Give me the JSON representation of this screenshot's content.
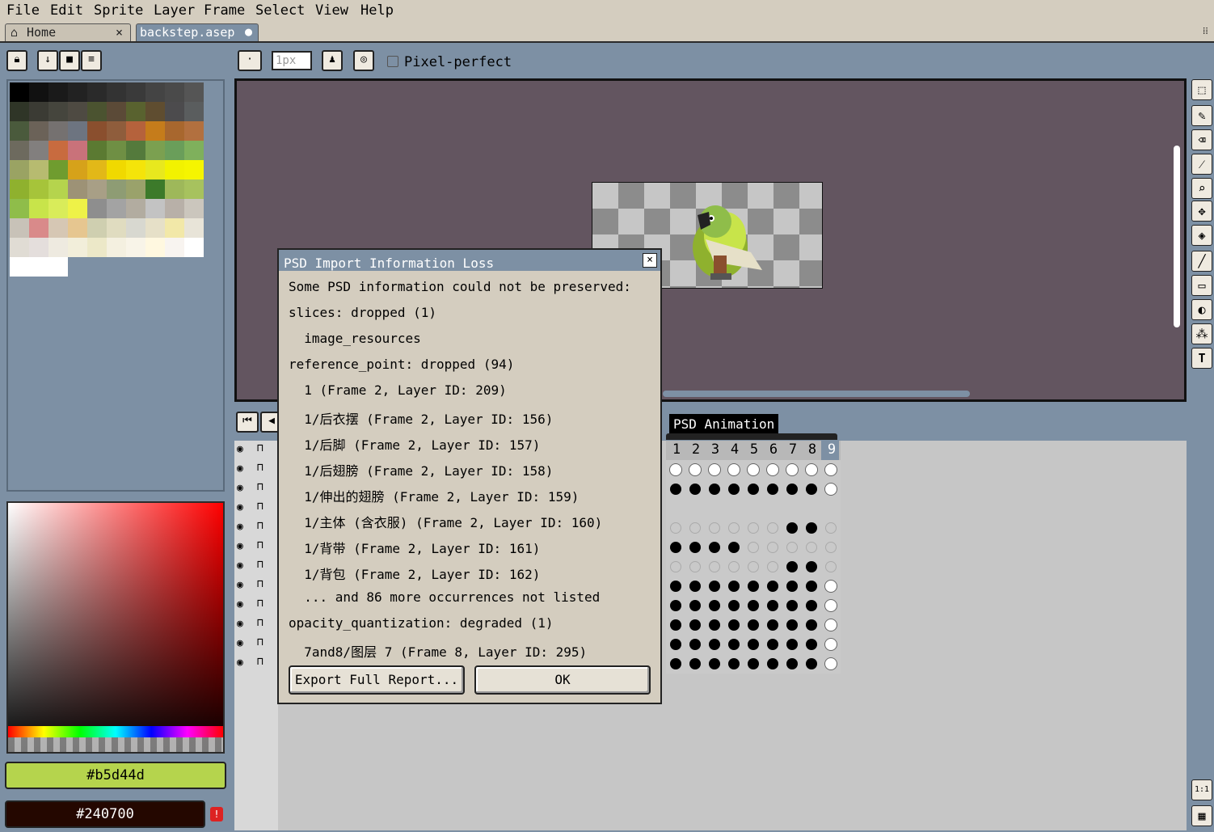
{
  "menu": [
    "File",
    "Edit",
    "Sprite",
    "Layer",
    "Frame",
    "Select",
    "View",
    "Help"
  ],
  "tabs": {
    "home": "Home",
    "file": "backstep.asep"
  },
  "toolbar": {
    "brush_size": "1px",
    "pixel_perfect": "Pixel-perfect"
  },
  "palette": {
    "colors": [
      "#000000",
      "#111111",
      "#1a1a1a",
      "#222222",
      "#2a2a2a",
      "#333333",
      "#3a3a3a",
      "#444444",
      "#4a4a4a",
      "#555555",
      "#2f3527",
      "#3b3b34",
      "#45453d",
      "#4e4a42",
      "#4b5330",
      "#5b4a37",
      "#59622f",
      "#5f4d30",
      "#4c4b4d",
      "#5a5d5e",
      "#4a5a3c",
      "#6b6258",
      "#757170",
      "#6d7480",
      "#8a4f2e",
      "#8f5d3c",
      "#b5623c",
      "#c57c1b",
      "#a8672e",
      "#b2703f",
      "#6d6a5e",
      "#827f7e",
      "#c86b3f",
      "#c9727a",
      "#5b7a32",
      "#6f8f44",
      "#547a3c",
      "#7ba050",
      "#6a9e5a",
      "#7fb05c",
      "#9aa363",
      "#b7bb70",
      "#6f9c2f",
      "#d6a21a",
      "#e2b818",
      "#f0d900",
      "#f4e40a",
      "#e8e81e",
      "#f2f200",
      "#f5f500",
      "#8fb12e",
      "#a6c43a",
      "#b5d44d",
      "#9d9276",
      "#a89f86",
      "#8e9c74",
      "#9aa26b",
      "#3c7a2a",
      "#9eb85a",
      "#a7c25e",
      "#8fbd4a",
      "#c8e44a",
      "#d9ec5a",
      "#eef248",
      "#8e8e8e",
      "#a3a3a3",
      "#b2aca0",
      "#c3c3c3",
      "#b8b0a8",
      "#cbc6bd",
      "#c8c2b8",
      "#d98a8a",
      "#d6c7b4",
      "#e6c690",
      "#cfcfb0",
      "#e0dcc0",
      "#d8d8d0",
      "#e6e0c8",
      "#f2e8a8",
      "#e8e4d8",
      "#e0dcd4",
      "#e4dedc",
      "#eeeae0",
      "#f2eeda",
      "#ece8c8",
      "#f4f0e0",
      "#f8f4e8",
      "#fff8e0",
      "#f8f4f0",
      "#ffffff",
      "#ffffff",
      "#ffffff",
      "#ffffff"
    ]
  },
  "colors": {
    "foreground": "#b5d44d",
    "background": "#240700"
  },
  "timeline": {
    "tag": "PSD Animation",
    "frames": [
      "1",
      "2",
      "3",
      "4",
      "5",
      "6",
      "7",
      "8",
      "9"
    ],
    "rows": [
      "eeeeeeeee",
      "ffffffffe",
      "---------",
      "ggggggffg",
      "ffffggggg",
      "ggggggffg",
      "ffffffffe",
      "ffffffffe",
      "ffffffffe",
      "ffffffffe",
      "ffffffffe"
    ]
  },
  "dialog": {
    "title": "PSD Import Information Loss",
    "lines": [
      "Some PSD information could not be preserved:",
      "slices: dropped (1)",
      "  image_resources",
      "reference_point: dropped (94)",
      "  1 (Frame 2, Layer ID: 209)",
      "  1/后衣摆 (Frame 2, Layer ID: 156)",
      "  1/后脚 (Frame 2, Layer ID: 157)",
      "  1/后翅膀 (Frame 2, Layer ID: 158)",
      "  1/伸出的翅膀 (Frame 2, Layer ID: 159)",
      "  1/主体 (含衣服) (Frame 2, Layer ID: 160)",
      "  1/背带 (Frame 2, Layer ID: 161)",
      "  1/背包 (Frame 2, Layer ID: 162)",
      "  ... and 86 more occurrences not listed",
      "opacity_quantization: degraded (1)",
      "  7and8/图层 7 (Frame 8, Layer ID: 295)"
    ],
    "export_button": "Export Full Report...",
    "ok_button": "OK"
  }
}
